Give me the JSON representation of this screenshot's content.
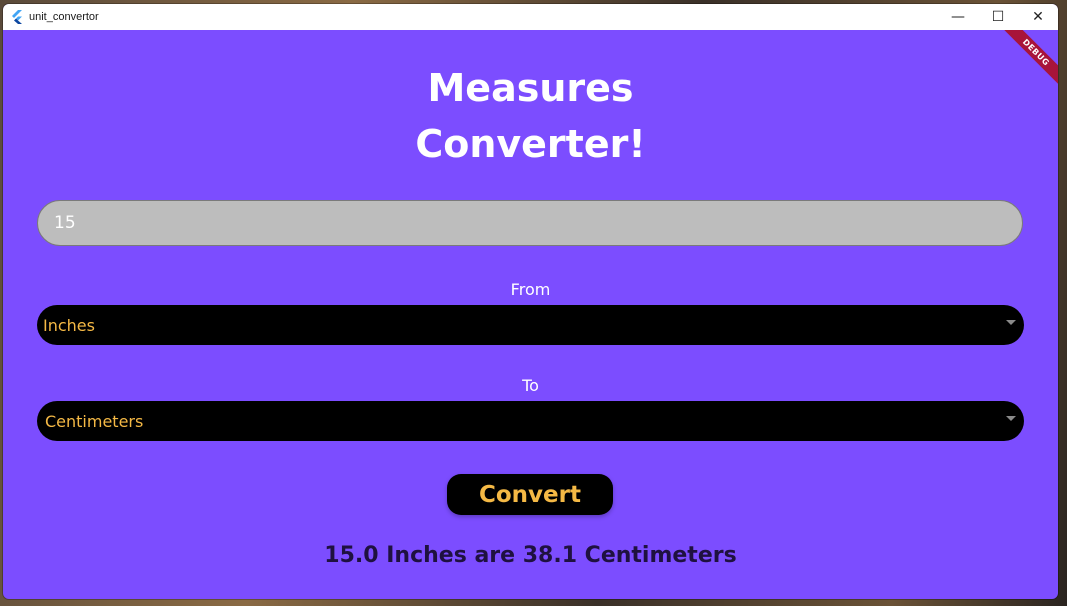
{
  "window": {
    "title": "unit_convertor",
    "controls": {
      "minimize": "—",
      "maximize": "☐",
      "close": "✕"
    },
    "debug_banner": "DEBUG"
  },
  "main": {
    "heading_line1": "Measures",
    "heading_line2": "Converter!",
    "input_value": "15",
    "from_label": "From",
    "from_value": "Inches",
    "to_label": "To",
    "to_value": "Centimeters",
    "convert_label": "Convert",
    "result_text": "15.0 Inches are 38.1 Centimeters"
  },
  "colors": {
    "background": "#7c4dff",
    "accent_text": "#f5b945",
    "control_bg": "#000000",
    "input_bg": "#bdbdbd",
    "result_text": "#1f1140"
  },
  "icons": {
    "app": "flutter-logo-icon",
    "dropdown": "dropdown-arrow-icon"
  }
}
